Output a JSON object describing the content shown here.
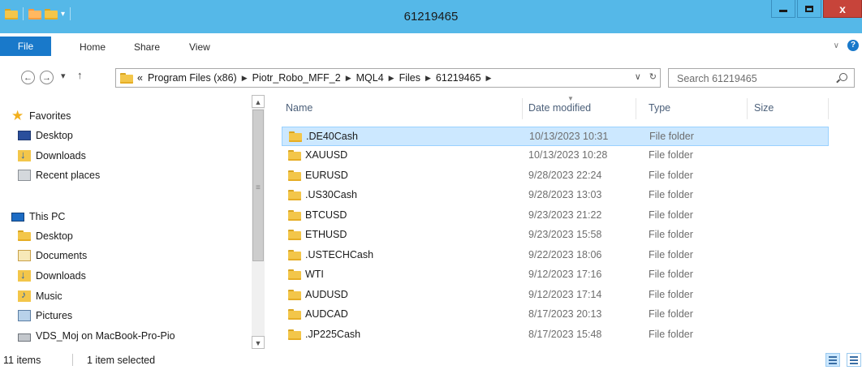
{
  "window": {
    "title": "61219465",
    "controls": {
      "minimize": "minimize",
      "maximize": "maximize",
      "close": "x"
    }
  },
  "ribbon": {
    "tabs": [
      "File",
      "Home",
      "Share",
      "View"
    ],
    "expand_icon": "chevron-down-icon",
    "help": "?"
  },
  "address": {
    "overflow": "«",
    "crumbs": [
      "Program Files (x86)",
      "Piotr_Robo_MFF_2",
      "MQL4",
      "Files",
      "61219465"
    ],
    "search_placeholder": "Search 61219465"
  },
  "nav": {
    "favorites_label": "Favorites",
    "favorites": [
      "Desktop",
      "Downloads",
      "Recent places"
    ],
    "thispc_label": "This PC",
    "thispc": [
      "Desktop",
      "Documents",
      "Downloads",
      "Music",
      "Pictures",
      "VDS_Moj on MacBook-Pro-Pio"
    ]
  },
  "columns": {
    "name": "Name",
    "date": "Date modified",
    "type": "Type",
    "size": "Size"
  },
  "files": [
    {
      "name": ".DE40Cash",
      "date": "10/13/2023 10:31",
      "type": "File folder",
      "selected": true
    },
    {
      "name": "XAUUSD",
      "date": "10/13/2023 10:28",
      "type": "File folder"
    },
    {
      "name": "EURUSD",
      "date": "9/28/2023 22:24",
      "type": "File folder"
    },
    {
      "name": ".US30Cash",
      "date": "9/28/2023 13:03",
      "type": "File folder"
    },
    {
      "name": "BTCUSD",
      "date": "9/23/2023 21:22",
      "type": "File folder"
    },
    {
      "name": "ETHUSD",
      "date": "9/23/2023 15:58",
      "type": "File folder"
    },
    {
      "name": ".USTECHCash",
      "date": "9/22/2023 18:06",
      "type": "File folder"
    },
    {
      "name": "WTI",
      "date": "9/12/2023 17:16",
      "type": "File folder"
    },
    {
      "name": "AUDUSD",
      "date": "9/12/2023 17:14",
      "type": "File folder"
    },
    {
      "name": "AUDCAD",
      "date": "8/17/2023 20:13",
      "type": "File folder"
    },
    {
      "name": ".JP225Cash",
      "date": "8/17/2023 15:48",
      "type": "File folder"
    }
  ],
  "status": {
    "count": "11 items",
    "selection": "1 item selected"
  }
}
